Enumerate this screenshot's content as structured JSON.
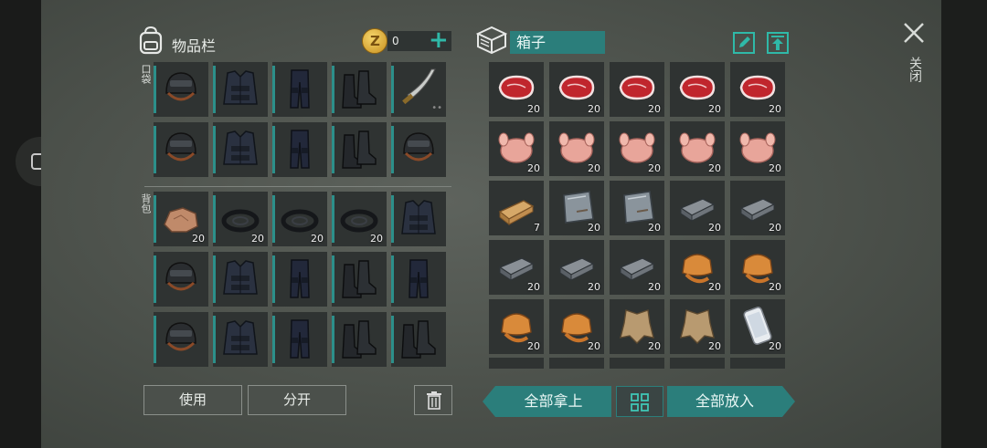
{
  "inventory": {
    "title": "物品栏",
    "coins": "0",
    "pocket_label": "口袋",
    "backpack_label": "背包",
    "pocket": [
      {
        "icon": "helmet"
      },
      {
        "icon": "vest"
      },
      {
        "icon": "pants"
      },
      {
        "icon": "boots"
      },
      {
        "icon": "machete",
        "dots": "••"
      },
      {
        "icon": "helmet"
      },
      {
        "icon": "vest"
      },
      {
        "icon": "pants"
      },
      {
        "icon": "boots"
      },
      {
        "icon": "helmet"
      }
    ],
    "backpack": [
      {
        "icon": "rock",
        "count": "20"
      },
      {
        "icon": "tire",
        "count": "20"
      },
      {
        "icon": "tire",
        "count": "20"
      },
      {
        "icon": "tire",
        "count": "20"
      },
      {
        "icon": "vest"
      },
      {
        "icon": "helmet"
      },
      {
        "icon": "vest"
      },
      {
        "icon": "pants"
      },
      {
        "icon": "boots"
      },
      {
        "icon": "pants"
      },
      {
        "icon": "helmet"
      },
      {
        "icon": "vest"
      },
      {
        "icon": "pants"
      },
      {
        "icon": "boots"
      },
      {
        "icon": "boots"
      }
    ],
    "use_label": "使用",
    "split_label": "分开"
  },
  "box": {
    "title": "箱子",
    "items": [
      {
        "icon": "steak",
        "count": "20"
      },
      {
        "icon": "steak",
        "count": "20"
      },
      {
        "icon": "steak",
        "count": "20"
      },
      {
        "icon": "steak",
        "count": "20"
      },
      {
        "icon": "steak",
        "count": "20"
      },
      {
        "icon": "chicken",
        "count": "20"
      },
      {
        "icon": "chicken",
        "count": "20"
      },
      {
        "icon": "chicken",
        "count": "20"
      },
      {
        "icon": "chicken",
        "count": "20"
      },
      {
        "icon": "chicken",
        "count": "20"
      },
      {
        "icon": "wood",
        "count": "7"
      },
      {
        "icon": "metal-plate",
        "count": "20"
      },
      {
        "icon": "metal-plate",
        "count": "20"
      },
      {
        "icon": "iron-ingot",
        "count": "20"
      },
      {
        "icon": "iron-ingot",
        "count": "20"
      },
      {
        "icon": "iron-ingot",
        "count": "20"
      },
      {
        "icon": "iron-ingot",
        "count": "20"
      },
      {
        "icon": "iron-ingot",
        "count": "20"
      },
      {
        "icon": "fox-pelt",
        "count": "20"
      },
      {
        "icon": "fox-pelt",
        "count": "20"
      },
      {
        "icon": "fox-pelt",
        "count": "20"
      },
      {
        "icon": "fox-pelt",
        "count": "20"
      },
      {
        "icon": "hide",
        "count": "20"
      },
      {
        "icon": "hide",
        "count": "20"
      },
      {
        "icon": "phone",
        "count": "20"
      }
    ],
    "take_all_label": "全部拿上",
    "put_all_label": "全部放入"
  },
  "close_label": "关闭",
  "colors": {
    "accent": "#2b7e7b",
    "panel": "#2f3332"
  }
}
